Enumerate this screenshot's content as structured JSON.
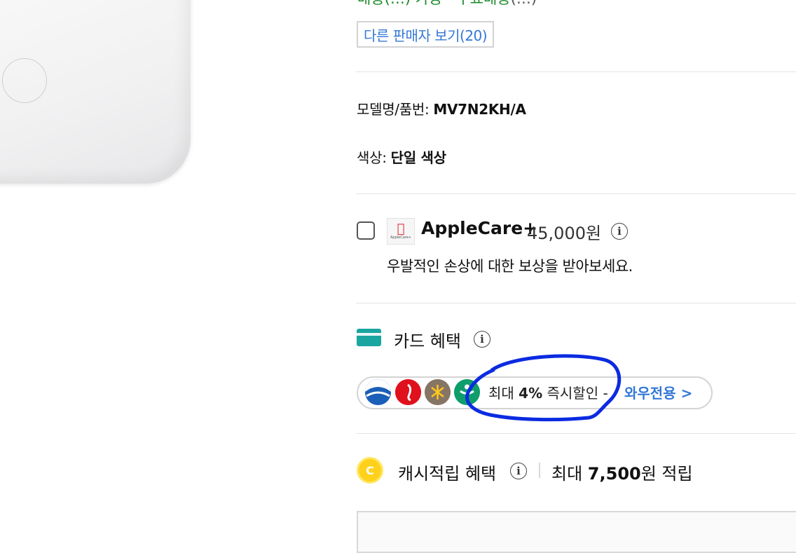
{
  "top": {
    "partial_text_green": "배송(…) 가능 · 무료배송",
    "partial_text_rest": "(…)",
    "other_sellers_label": "다른 판매자 보기(20)"
  },
  "specs": {
    "model_label": "모델명/품번:",
    "model_value": "MV7N2KH/A",
    "color_label": "색상:",
    "color_value": "단일 색상"
  },
  "applecare": {
    "logo_text": "AppleCare+",
    "title": "AppleCare+",
    "price": "45,000원",
    "description": "우발적인 손상에 대한 보상을 받아보세요.",
    "checked": false
  },
  "card_benefits": {
    "title": "카드 혜택",
    "promo_prefix": "최대 ",
    "promo_percent": "4%",
    "promo_suffix": " 즉시할인 -",
    "promo_link": "와우전용 >",
    "banks": [
      "bank-1",
      "bank-2",
      "bank-3",
      "bank-4"
    ]
  },
  "cash": {
    "coin_letter": "C",
    "title": "캐시적립 혜택",
    "max_prefix": "최대 ",
    "max_amount": "7,500",
    "max_suffix": "원 적립"
  },
  "colors": {
    "link_blue": "#3478d6",
    "annotation_blue": "#0b2be0",
    "card_teal": "#1aa5a0",
    "coin_yellow": "#ffd11a"
  }
}
